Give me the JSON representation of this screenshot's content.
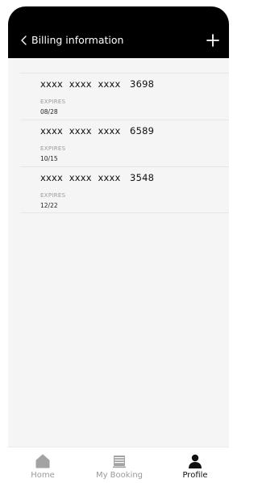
{
  "header": {
    "title": "Billing information",
    "back_icon": "chevron-left-icon",
    "add_icon": "plus-icon",
    "background": "#000000"
  },
  "cards": [
    {
      "number": "xxxx  xxxx  xxxx   3698",
      "expires_label": "EXPIRES",
      "expires": "08/28"
    },
    {
      "number": "xxxx  xxxx  xxxx   6589",
      "expires_label": "EXPIRES",
      "expires": "10/15"
    },
    {
      "number": "xxxx  xxxx  xxxx   3548",
      "expires_label": "EXPIRES",
      "expires": "12/22"
    }
  ],
  "bottom_nav": {
    "items": [
      {
        "label": "Home",
        "icon": "home-icon",
        "active": false
      },
      {
        "label": "My Booking",
        "icon": "booking-icon",
        "active": false
      },
      {
        "label": "Profile",
        "icon": "profile-icon",
        "active": true
      }
    ],
    "active_color": "#111111",
    "inactive_color": "#9a9a9a"
  }
}
